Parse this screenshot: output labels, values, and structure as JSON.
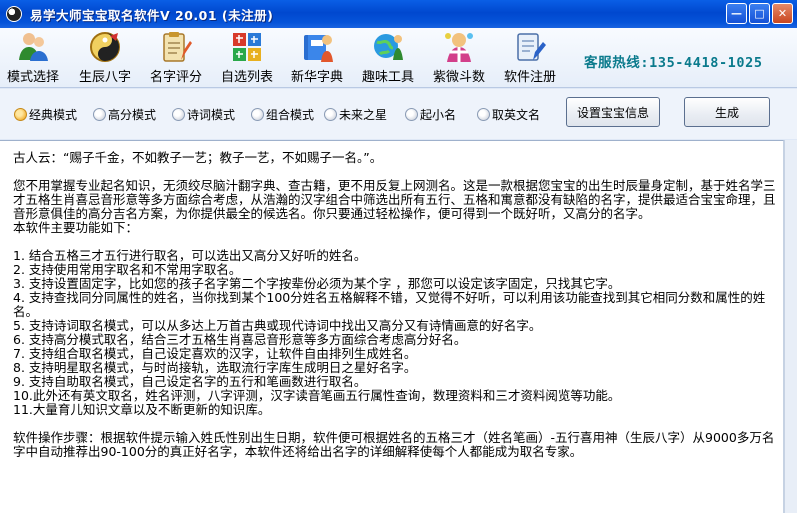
{
  "window": {
    "title": "易学大师宝宝取名软件V 20.01 (未注册)",
    "minimize_label": "—",
    "maximize_label": "□",
    "close_label": "✕"
  },
  "toolbar": {
    "items": [
      {
        "label": "模式选择",
        "icon": "people-icon"
      },
      {
        "label": "生辰八字",
        "icon": "bagua-icon"
      },
      {
        "label": "名字评分",
        "icon": "clipboard-pencil-icon"
      },
      {
        "label": "自选列表",
        "icon": "character-list-icon"
      },
      {
        "label": "新华字典",
        "icon": "dictionary-icon"
      },
      {
        "label": "趣味工具",
        "icon": "globe-person-icon"
      },
      {
        "label": "紫微斗数",
        "icon": "zodiac-person-icon"
      },
      {
        "label": "软件注册",
        "icon": "register-notepad-icon"
      }
    ],
    "hotline": "客服热线:135-4418-1025"
  },
  "modes": {
    "options": [
      "经典模式",
      "高分模式",
      "诗词模式",
      "组合模式",
      "未来之星",
      "起小名",
      "取英文名"
    ],
    "selected": "经典模式",
    "settings_button": "设置宝宝信息",
    "generate_button": "生成"
  },
  "content": {
    "quote": "古人云：“赐子千金，不如教子一艺；教子一艺，不如赐子一名。”。",
    "intro": "您不用掌握专业起名知识，无须绞尽脑汁翻字典、查古籍，更不用反复上网测名。这是一款根据您宝宝的出生时辰量身定制，基于姓名学三才五格生肖喜忌音形意等多方面综合考虑，从浩瀚的汉字组合中筛选出所有五行、五格和寓意都没有缺陷的名字，提供最适合宝宝命理，且音形意俱佳的高分吉名方案，为你提供最全的候选名。你只要通过轻松操作，便可得到一个既好听，又高分的名字。\n本软件主要功能如下：",
    "features": "1. 结合五格三才五行进行取名，可以选出又高分又好听的姓名。\n2. 支持使用常用字取名和不常用字取名。\n3. 支持设置固定字，比如您的孩子名字第二个字按辈份必须为某个字 ，那您可以设定该字固定，只找其它字。\n4. 支持查找同分同属性的姓名，当你找到某个100分姓名五格解释不错，又觉得不好听，可以利用该功能查找到其它相同分数和属性的姓名。\n5. 支持诗词取名模式，可以从多达上万首古典或现代诗词中找出又高分又有诗情画意的好名字。\n6. 支持高分模式取名，结合三才五格生肖喜忌音形意等多方面综合考虑高分好名。\n7. 支持组合取名模式，自己设定喜欢的汉字，让软件自由排列生成姓名。\n8. 支持明星取名模式，与时尚接轨，选取流行字库生成明日之星好名字。\n9. 支持自助取名模式，自己设定名字的五行和笔画数进行取名。\n10.此外还有英文取名，姓名评测，八字评测，汉字读音笔画五行属性查询，数理资料和三才资料阅览等功能。\n11.大量育儿知识文章以及不断更新的知识库。",
    "steps": "软件操作步骤：根据软件提示输入姓氏性别出生日期，软件便可根据姓名的五格三才（姓名笔画）-五行喜用神（生辰八字）从9000多万名字中自动推荐出90-100分的真正好名字，本软件还将给出名字的详细解释使每个人都能成为取名专家。"
  },
  "colors": {
    "titlebar": "#0a5fe6",
    "hotline": "#0a7a8c",
    "selected_radio": "#f2b33a"
  }
}
